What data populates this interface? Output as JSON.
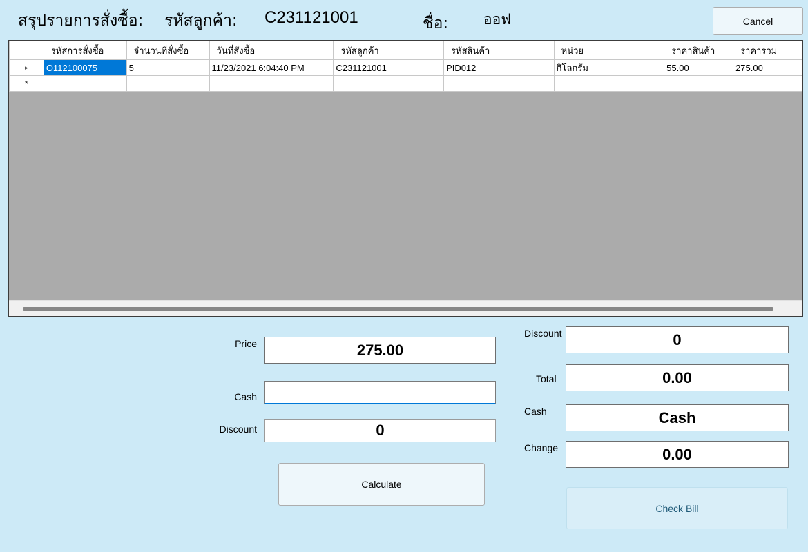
{
  "header": {
    "title": "สรุปรายการสั่งซื้อ:",
    "customer_id_label": "รหัสลูกค้า:",
    "customer_id": "C231121001",
    "name_label": "ชื่อ:",
    "name": "ออฟ",
    "cancel_label": "Cancel"
  },
  "grid": {
    "columns": [
      "รหัสการสั่งซื้อ",
      "จำนวนที่สั่งซื้อ",
      "วันที่สั่งซื้อ",
      "รหัสลูกค้า",
      "รหัสสินค้า",
      "หน่วย",
      "ราคาสินค้า",
      "ราคารวม"
    ],
    "rows": [
      [
        "O112100075",
        "5",
        "11/23/2021 6:04:40 PM",
        "C231121001",
        "PID012",
        "กิโลกรัม",
        "55.00",
        "275.00"
      ]
    ],
    "current_row_marker": "▸",
    "new_row_marker": "*"
  },
  "left_panel": {
    "price_label": "Price",
    "price_value": "275.00",
    "cash_label": "Cash",
    "cash_value": "",
    "discount_label": "Discount",
    "discount_value": "0",
    "calculate_label": "Calculate"
  },
  "right_panel": {
    "discount_label": "Discount",
    "discount_value": "0",
    "total_label": "Total",
    "total_value": "0.00",
    "cash_label": "Cash",
    "cash_value": "Cash",
    "change_label": "Change",
    "change_value": "0.00",
    "check_bill_label": "Check Bill"
  },
  "colors": {
    "background": "#cdeaf7",
    "selection": "#0078d7",
    "grid_empty": "#ababab"
  }
}
